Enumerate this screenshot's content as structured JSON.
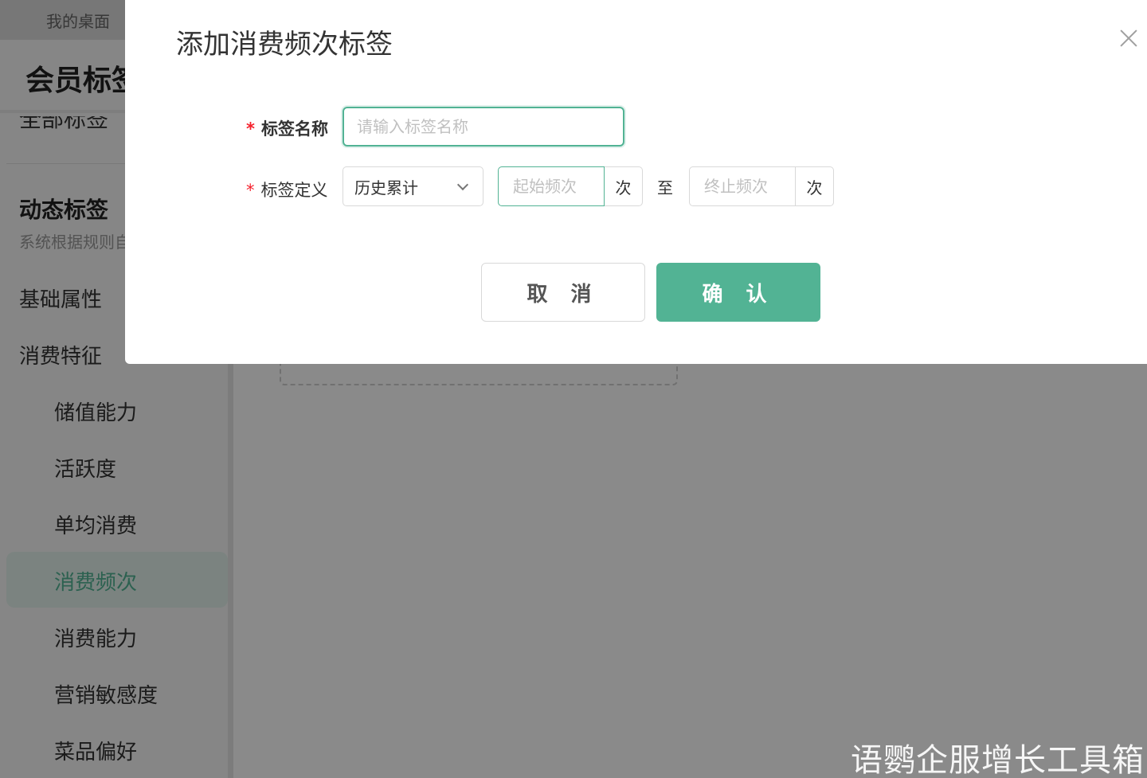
{
  "topbar": {
    "desktop_tab": "我的桌面"
  },
  "sidebar": {
    "page_title": "会员标签",
    "cut_text": "全部标签",
    "section_title": "动态标签",
    "section_subtitle": "系统根据规则自",
    "items": [
      {
        "label": "基础属性"
      },
      {
        "label": "消费特征"
      }
    ],
    "sub_items": [
      {
        "label": "储值能力"
      },
      {
        "label": "活跃度"
      },
      {
        "label": "单均消费"
      },
      {
        "label": "消费频次"
      },
      {
        "label": "消费能力"
      },
      {
        "label": "营销敏感度"
      },
      {
        "label": "菜品偏好"
      }
    ],
    "active_item": "消费频次"
  },
  "modal": {
    "title": "添加消费频次标签",
    "name_label": "标签名称",
    "name_placeholder": "请输入标签名称",
    "name_value": "",
    "def_label": "标签定义",
    "def_select_value": "历史累计",
    "start_placeholder": "起始频次",
    "start_unit": "次",
    "to_text": "至",
    "end_placeholder": "终止频次",
    "end_unit": "次",
    "cancel_label": "取 消",
    "confirm_label": "确 认"
  },
  "watermark": "语鹦企服增长工具箱",
  "colors": {
    "accent": "#52b394",
    "required": "#f5222d",
    "mask": "rgba(0,0,0,0.46)"
  }
}
